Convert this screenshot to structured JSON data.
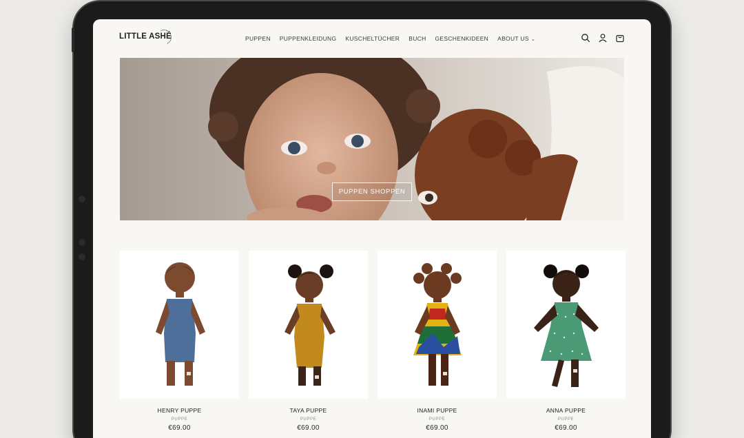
{
  "brand": {
    "name": "LITTLE ASHÉ",
    "ring_text": "by Neiba"
  },
  "nav": {
    "items": [
      "PUPPEN",
      "PUPPENKLEIDUNG",
      "KUSCHELTÜCHER",
      "BUCH",
      "GESCHENKIDEEN",
      "ABOUT US"
    ],
    "dropdown_chevron": "⌄"
  },
  "header_icons": [
    "search-icon",
    "account-icon",
    "cart-icon"
  ],
  "hero": {
    "button_label": "PUPPEN SHOPPEN"
  },
  "products": [
    {
      "name": "HENRY PUPPE",
      "type": "PUPPE",
      "price": "€69.00"
    },
    {
      "name": "TAYA PUPPE",
      "type": "PUPPE",
      "price": "€69.00"
    },
    {
      "name": "INAMI PUPPE",
      "type": "PUPPE",
      "price": "€69.00"
    },
    {
      "name": "ANNA PUPPE",
      "type": "PUPPE",
      "price": "€69.00"
    }
  ],
  "colors": {
    "page_bg": "#f8f7f4",
    "text": "#1e1e1e",
    "device_frame": "#1b1b1b"
  }
}
